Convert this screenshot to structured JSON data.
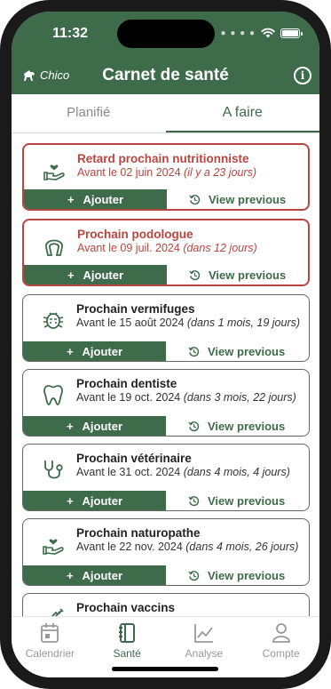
{
  "status": {
    "time": "11:32"
  },
  "header": {
    "pet_name": "Chico",
    "title": "Carnet de santé"
  },
  "tabs": [
    {
      "label": "Planifié"
    },
    {
      "label": "A faire"
    }
  ],
  "buttons": {
    "add_label": "Ajouter",
    "previous_label": "View previous"
  },
  "colors": {
    "primary": "#3e6b4a",
    "overdue": "#b5473f"
  },
  "cards": [
    {
      "icon": "hand-heart-icon",
      "title": "Retard prochain nutritionniste",
      "date": "Avant le 02 juin 2024",
      "relative": "(il y a 23 jours)",
      "overdue": true
    },
    {
      "icon": "horseshoe-icon",
      "title": "Prochain podologue",
      "date": "Avant le 09 juil. 2024",
      "relative": "(dans 12 jours)",
      "overdue": true
    },
    {
      "icon": "bug-icon",
      "title": "Prochain vermifuges",
      "date": "Avant le 15 août 2024",
      "relative": "(dans 1 mois, 19 jours)",
      "overdue": false
    },
    {
      "icon": "tooth-icon",
      "title": "Prochain dentiste",
      "date": "Avant le 19 oct. 2024",
      "relative": "(dans 3 mois, 22 jours)",
      "overdue": false
    },
    {
      "icon": "stethoscope-icon",
      "title": "Prochain vétérinaire",
      "date": "Avant le 31 oct. 2024",
      "relative": "(dans 4 mois, 4 jours)",
      "overdue": false
    },
    {
      "icon": "hand-heart-icon",
      "title": "Prochain naturopathe",
      "date": "Avant le 22 nov. 2024",
      "relative": "(dans 4 mois, 26 jours)",
      "overdue": false
    },
    {
      "icon": "syringe-icon",
      "title": "Prochain vaccins",
      "date": "",
      "relative": "",
      "overdue": false
    }
  ],
  "nav": [
    {
      "label": "Calendrier",
      "icon": "calendar-icon",
      "active": false
    },
    {
      "label": "Santé",
      "icon": "notebook-icon",
      "active": true
    },
    {
      "label": "Analyse",
      "icon": "chart-icon",
      "active": false
    },
    {
      "label": "Compte",
      "icon": "user-icon",
      "active": false
    }
  ]
}
